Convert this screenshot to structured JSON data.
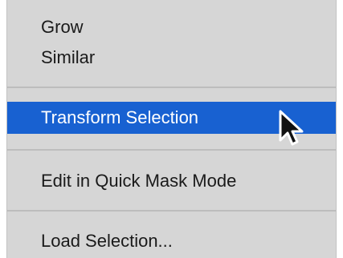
{
  "menu": {
    "items": [
      {
        "label": "Grow",
        "highlighted": false
      },
      {
        "label": "Similar",
        "highlighted": false
      },
      {
        "label": "Transform Selection",
        "highlighted": true
      },
      {
        "label": "Edit in Quick Mask Mode",
        "highlighted": false
      },
      {
        "label": "Load Selection...",
        "highlighted": false
      }
    ]
  },
  "colors": {
    "menu_background": "#d6d6d6",
    "highlight": "#1861d1",
    "separator": "#bdbdbd"
  },
  "icons": {
    "cursor": "mouse-pointer-icon"
  }
}
